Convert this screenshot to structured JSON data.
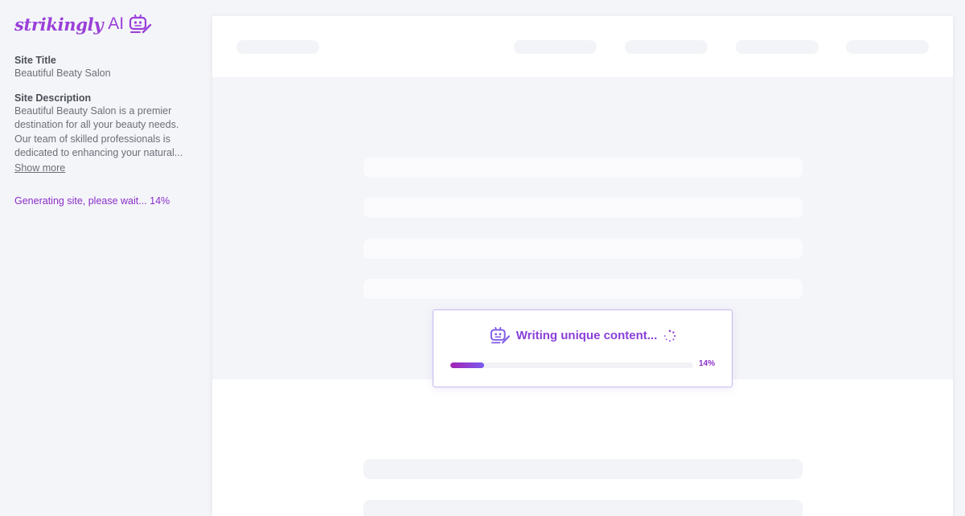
{
  "brand": {
    "name": "strikingly",
    "suffix": "AI",
    "icon": "robot-pencil-icon",
    "color": "#9a3fd9"
  },
  "sidebar": {
    "site_title_label": "Site Title",
    "site_title_value": "Beautiful Beaty Salon",
    "site_description_label": "Site Description",
    "site_description_value": "Beautiful Beauty Salon is a premier destination for all your beauty needs. Our team of skilled professionals is dedicated to enhancing your natural...",
    "show_more_label": "Show more",
    "status_text": "Generating site, please wait... 14%"
  },
  "progress_card": {
    "icon": "robot-pencil-icon",
    "title": "Writing unique content...",
    "spinner_icon": "spinner-icon",
    "percent_label": "14%",
    "progress": 0.14,
    "accent_color": "#8a3fd9"
  }
}
